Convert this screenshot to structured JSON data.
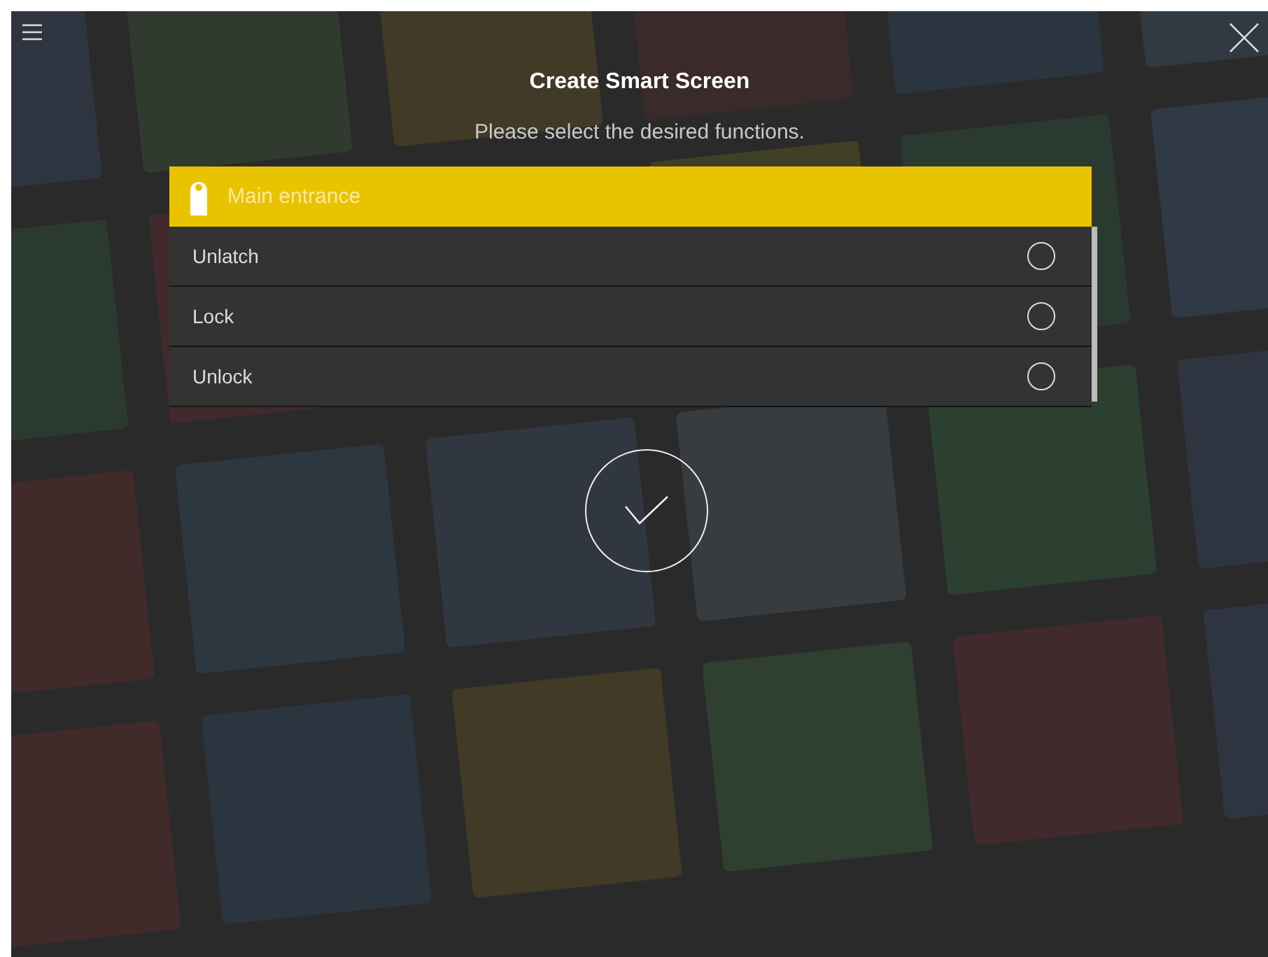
{
  "title": "Create Smart Screen",
  "subtitle": "Please select the desired functions.",
  "group": {
    "label": "Main entrance"
  },
  "functions": [
    {
      "label": "Unlatch",
      "selected": false
    },
    {
      "label": "Lock",
      "selected": false
    },
    {
      "label": "Unlock",
      "selected": false
    }
  ]
}
